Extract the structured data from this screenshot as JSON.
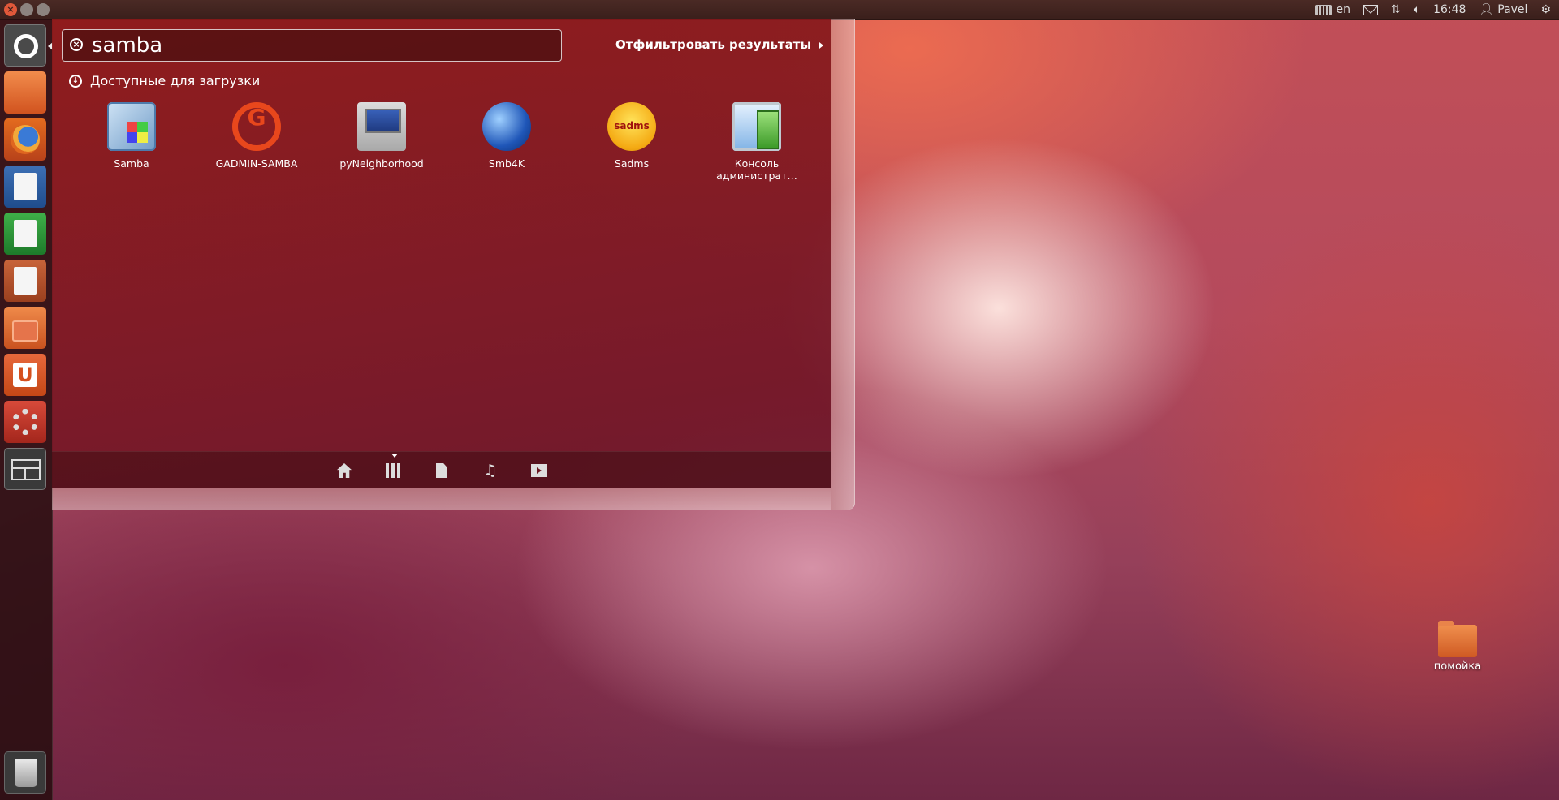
{
  "top_panel": {
    "keyboard_layout": "en",
    "clock": "16:48",
    "user": "Pavel",
    "icons": [
      "keyboard-icon",
      "mail-icon",
      "network-icon",
      "volume-icon",
      "user-icon",
      "session-gear-icon"
    ]
  },
  "launcher": {
    "items": [
      "dash-home",
      "files",
      "firefox",
      "libreoffice-writer",
      "libreoffice-calc",
      "libreoffice-impress",
      "software-center",
      "ubuntu-one",
      "system-settings",
      "workspace-switcher",
      "trash"
    ]
  },
  "dash": {
    "search": {
      "value": "samba",
      "placeholder": ""
    },
    "filter_label": "Отфильтровать результаты",
    "category_title": "Доступные для загрузки",
    "results": [
      {
        "label": "Samba",
        "icon": "samba-icon"
      },
      {
        "label": "GADMIN-SAMBA",
        "icon": "gadmin-samba-icon"
      },
      {
        "label": "pyNeighborhood",
        "icon": "pyneighborhood-icon"
      },
      {
        "label": "Smb4K",
        "icon": "smb4k-icon"
      },
      {
        "label": "Sadms",
        "icon": "sadms-icon"
      },
      {
        "label": "Консоль администрат…",
        "icon": "console-icon"
      }
    ],
    "lenses": [
      "home-lens",
      "applications-lens",
      "files-lens",
      "music-lens",
      "video-lens"
    ],
    "active_lens": "applications-lens"
  },
  "desktop": {
    "icons": [
      {
        "label": "помойка",
        "icon": "folder-icon"
      }
    ]
  },
  "colors": {
    "dash_bg": "#8c1818",
    "panel_bg": "#3a1f1b",
    "accent": "#e95420"
  }
}
